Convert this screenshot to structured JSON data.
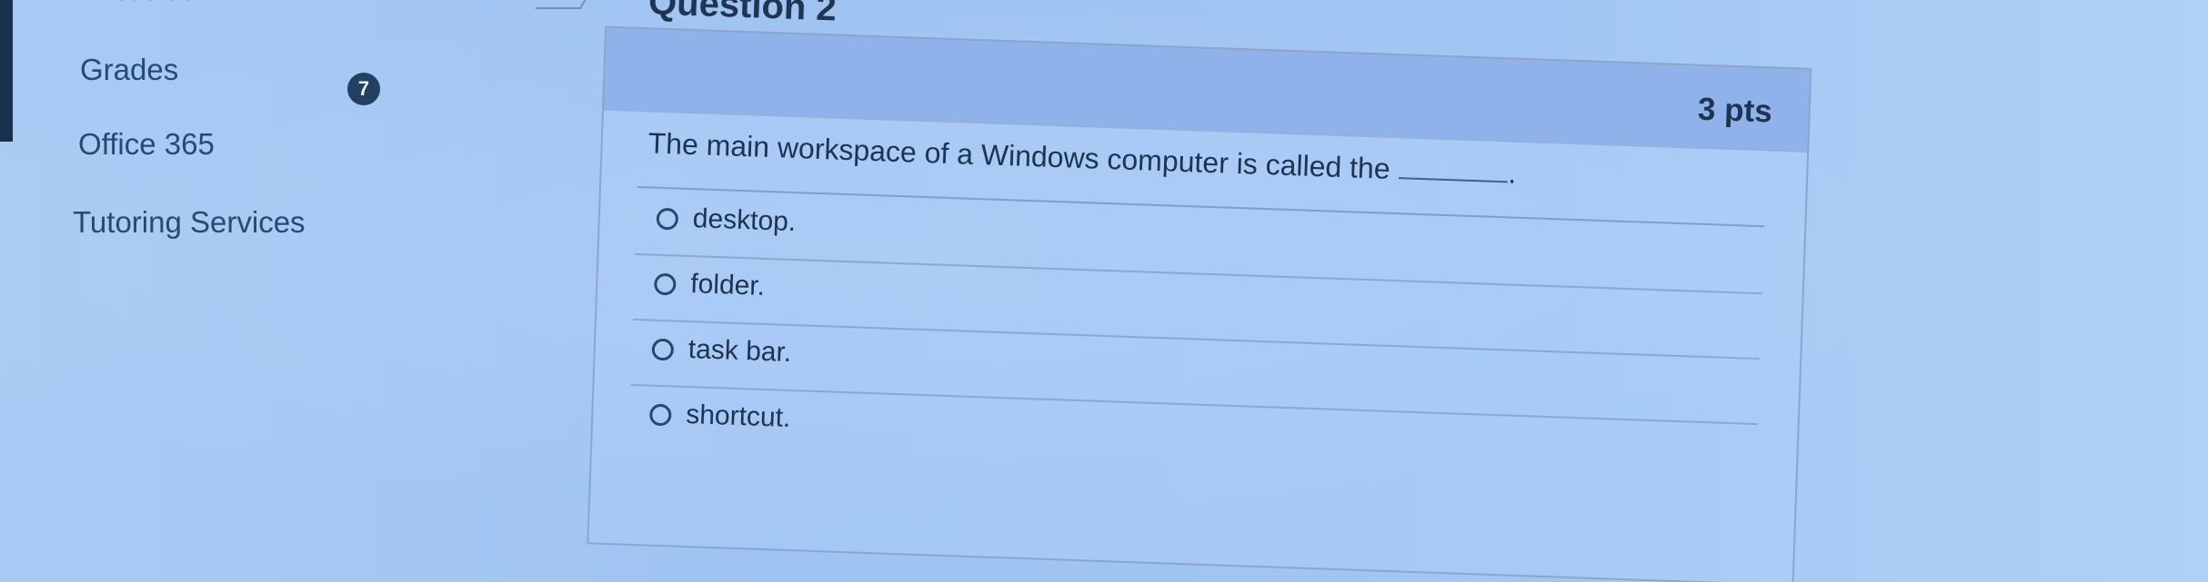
{
  "nav": {
    "partial_label": "Modules",
    "items": [
      {
        "label": "Grades",
        "badge": "7"
      },
      {
        "label": "Office 365"
      },
      {
        "label": "Tutoring Services"
      }
    ]
  },
  "question": {
    "title": "Question 2",
    "points": "3 pts",
    "prompt": "The main workspace of a Windows computer is called the",
    "prompt_end": ".",
    "answers": [
      {
        "label": "desktop."
      },
      {
        "label": "folder."
      },
      {
        "label": "task bar."
      },
      {
        "label": "shortcut."
      }
    ]
  },
  "colors": {
    "background": "#a3c6f2",
    "header": "#8fb2ea",
    "text": "#1e3352",
    "badge": "#234060",
    "nav_text": "#244b74"
  }
}
